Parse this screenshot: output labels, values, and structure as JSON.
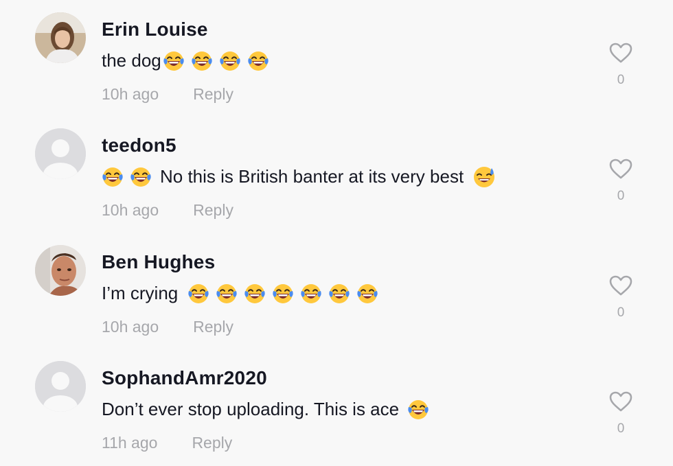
{
  "comments": [
    {
      "username": "Erin Louise",
      "avatar": "photo-woman",
      "text_before": "the dog",
      "emojis_before": 0,
      "emojis_after": 4,
      "text_after": "",
      "trailing_emoji": "",
      "time": "10h ago",
      "reply_label": "Reply",
      "likes": "0"
    },
    {
      "username": "teedon5",
      "avatar": "default-avatar",
      "text_before": "",
      "emojis_before": 2,
      "text_after": "No this is British banter at its very best",
      "trailing_emoji": "sweat-smile-emoji",
      "emojis_after": 0,
      "time": "10h ago",
      "reply_label": "Reply",
      "likes": "0"
    },
    {
      "username": "Ben Hughes",
      "avatar": "photo-man",
      "text_before": "I’m crying",
      "emojis_before": 0,
      "emojis_after": 7,
      "text_after": "",
      "trailing_emoji": "",
      "time": "10h ago",
      "reply_label": "Reply",
      "likes": "0"
    },
    {
      "username": "SophandAmr2020",
      "avatar": "default-avatar",
      "text_before": "Don’t ever stop uploading. This is ace",
      "emojis_before": 0,
      "emojis_after": 1,
      "text_after": "",
      "trailing_emoji": "",
      "time": "11h ago",
      "reply_label": "Reply",
      "likes": "0"
    }
  ],
  "icons": {
    "emoji": "face-with-tears-of-joy-emoji",
    "like": "heart-outline-icon"
  },
  "colors": {
    "background": "#f8f8f8",
    "text": "#161823",
    "muted": "#a6a7ab",
    "emoji_face": "#ffc83d"
  }
}
